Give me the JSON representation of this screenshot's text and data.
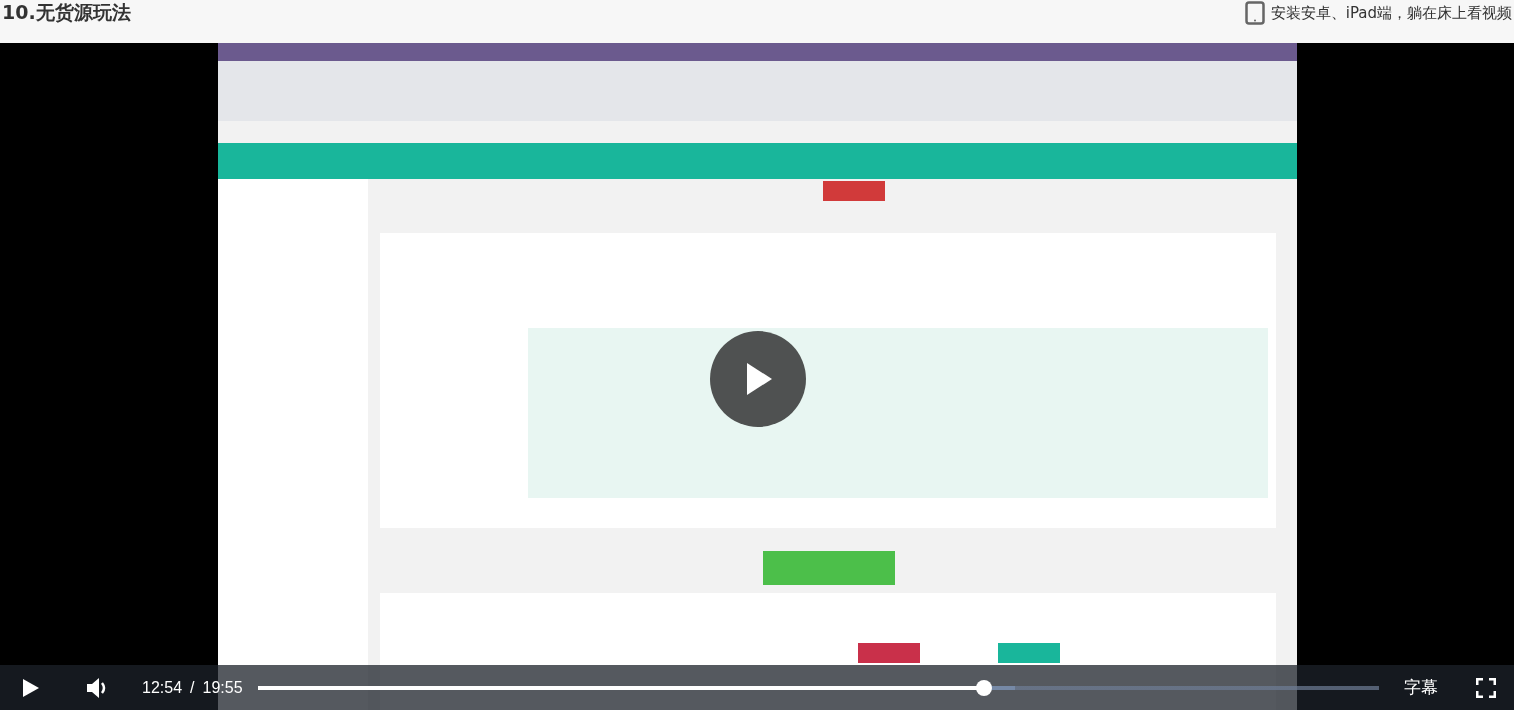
{
  "header": {
    "title": "10.无货源玩法",
    "app_promo": "安装安卓、iPad端，躺在床上看视频"
  },
  "video": {
    "kind": "picture",
    "paused": true
  },
  "controls": {
    "current_time": "12:54",
    "separator": "/",
    "duration": "19:55",
    "progress": {
      "level": 0.648
    },
    "buffered": {
      "level": 0.675
    },
    "subtitles": "字幕"
  }
}
